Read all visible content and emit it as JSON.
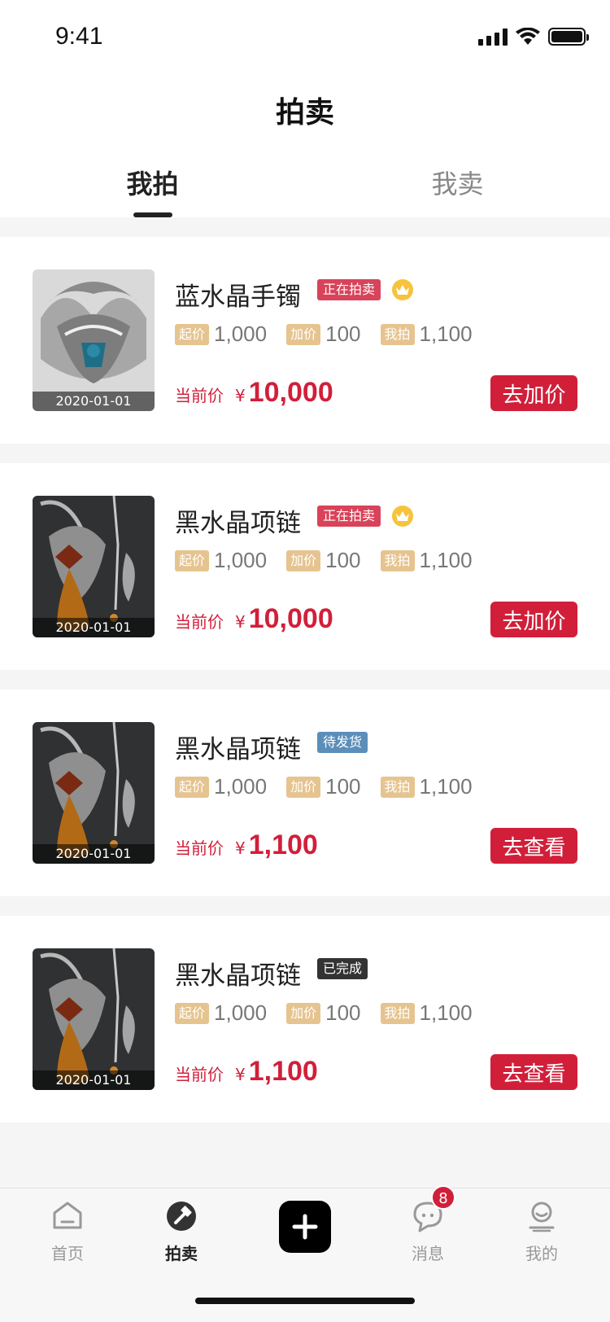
{
  "status_bar": {
    "time": "9:41"
  },
  "nav": {
    "title": "拍卖"
  },
  "tabs": [
    {
      "label": "我拍",
      "active": true
    },
    {
      "label": "我卖",
      "active": false
    }
  ],
  "labels": {
    "start_price": "起价",
    "increment": "加价",
    "my_bid": "我拍",
    "current_price": "当前价",
    "currency": "¥"
  },
  "items": [
    {
      "title": "蓝水晶手镯",
      "status": "正在拍卖",
      "status_color": "#d9435a",
      "crown": true,
      "date": "2020-01-01",
      "start_price": "1,000",
      "increment": "100",
      "my_bid": "1,100",
      "current_price": "10,000",
      "action": "去加价",
      "image": "swan-bracelet"
    },
    {
      "title": "黑水晶项链",
      "status": "正在拍卖",
      "status_color": "#d9435a",
      "crown": true,
      "date": "2020-01-01",
      "start_price": "1,000",
      "increment": "100",
      "my_bid": "1,100",
      "current_price": "10,000",
      "action": "去加价",
      "image": "black-necklace"
    },
    {
      "title": "黑水晶项链",
      "status": "待发货",
      "status_color": "#5b8fb9",
      "crown": false,
      "date": "2020-01-01",
      "start_price": "1,000",
      "increment": "100",
      "my_bid": "1,100",
      "current_price": "1,100",
      "action": "去查看",
      "image": "black-necklace"
    },
    {
      "title": "黑水晶项链",
      "status": "已完成",
      "status_color": "#333333",
      "crown": false,
      "date": "2020-01-01",
      "start_price": "1,000",
      "increment": "100",
      "my_bid": "1,100",
      "current_price": "1,100",
      "action": "去查看",
      "image": "black-necklace"
    }
  ],
  "tabbar": {
    "home": "首页",
    "auction": "拍卖",
    "messages": "消息",
    "messages_badge": "8",
    "mine": "我的"
  },
  "colors": {
    "accent": "#d11f3a",
    "price_tag": "#e6c48f"
  }
}
